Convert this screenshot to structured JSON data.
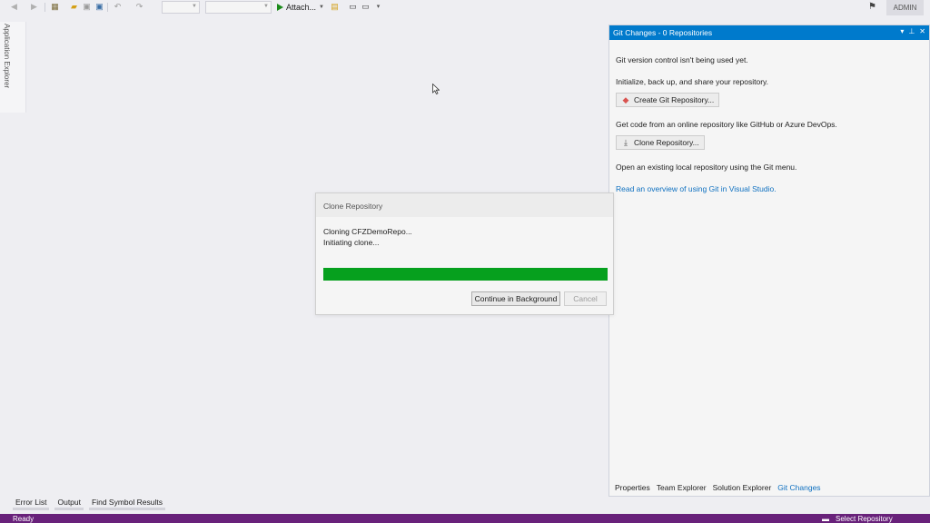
{
  "toolbar": {
    "attach_label": "Attach...",
    "admin_label": "ADMIN",
    "icons": [
      "back-icon",
      "forward-icon",
      "new-project-icon",
      "open-folder-icon",
      "save-icon",
      "save-all-icon",
      "undo-icon",
      "redo-icon",
      "play-icon",
      "feedback-icon"
    ]
  },
  "side_tab": {
    "label": "Application Explorer"
  },
  "git_panel": {
    "title": "Git Changes - 0 Repositories",
    "intro": "Git version control isn't being used yet.",
    "init_text": "Initialize, back up, and share your repository.",
    "create_button": "Create Git Repository...",
    "online_text": "Get code from an online repository like GitHub or Azure DevOps.",
    "clone_button": "Clone Repository...",
    "existing_text": "Open an existing local repository using the Git menu.",
    "overview_link": "Read an overview of using Git in Visual Studio."
  },
  "panel_tabs": [
    {
      "label": "Properties",
      "active": false
    },
    {
      "label": "Team Explorer",
      "active": false
    },
    {
      "label": "Solution Explorer",
      "active": false
    },
    {
      "label": "Git Changes",
      "active": true
    }
  ],
  "dialog": {
    "title": "Clone Repository",
    "line1": "Cloning CFZDemoRepo...",
    "line2": "Initiating clone...",
    "progress": 1.0,
    "progress_color": "#06a01e",
    "continue_button": "Continue in Background",
    "cancel_button": "Cancel"
  },
  "bottom_tabs": [
    "Error List",
    "Output",
    "Find Symbol Results"
  ],
  "status_bar": {
    "left": "Ready",
    "right": "Select Repository",
    "color": "#68217a"
  },
  "colors": {
    "accent": "#007acc",
    "link": "#0e70c0"
  }
}
